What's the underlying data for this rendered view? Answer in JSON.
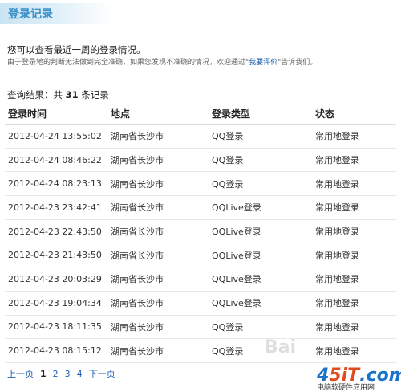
{
  "page": {
    "title": "登录记录"
  },
  "intro": {
    "line1": "您可以查看最近一周的登录情况。",
    "line2_prefix": "由于登录地的判断无法做到完全准确，如果您发现不准确的情况，欢迎通过\"",
    "line2_link": "我要评价",
    "line2_suffix": "\"告诉我们。"
  },
  "summary": {
    "prefix": "查询结果：共",
    "count": "31",
    "suffix": "条记录"
  },
  "table": {
    "headers": [
      "登录时间",
      "地点",
      "登录类型",
      "状态"
    ],
    "rows": [
      [
        "2012-04-24 13:55:02",
        "湖南省长沙市",
        "QQ登录",
        "常用地登录"
      ],
      [
        "2012-04-24 08:46:22",
        "湖南省长沙市",
        "QQ登录",
        "常用地登录"
      ],
      [
        "2012-04-24 08:23:13",
        "湖南省长沙市",
        "QQ登录",
        "常用地登录"
      ],
      [
        "2012-04-23 23:42:41",
        "湖南省长沙市",
        "QQLive登录",
        "常用地登录"
      ],
      [
        "2012-04-23 22:43:50",
        "湖南省长沙市",
        "QQLive登录",
        "常用地登录"
      ],
      [
        "2012-04-23 21:43:50",
        "湖南省长沙市",
        "QQLive登录",
        "常用地登录"
      ],
      [
        "2012-04-23 20:03:29",
        "湖南省长沙市",
        "QQLive登录",
        "常用地登录"
      ],
      [
        "2012-04-23 19:04:34",
        "湖南省长沙市",
        "QQLive登录",
        "常用地登录"
      ],
      [
        "2012-04-23 18:11:35",
        "湖南省长沙市",
        "QQ登录",
        "常用地登录"
      ],
      [
        "2012-04-23 08:15:12",
        "湖南省长沙市",
        "QQ登录",
        "常用地登录"
      ]
    ]
  },
  "pager": {
    "prev": "上一页",
    "pages": [
      "1",
      "2",
      "3",
      "4"
    ],
    "next": "下一页"
  },
  "watermark": {
    "baidu": "Bai",
    "site_a": "4",
    "site_b": "5iT",
    "site_c": ".com",
    "sub": "电脑软硬件应用网"
  }
}
